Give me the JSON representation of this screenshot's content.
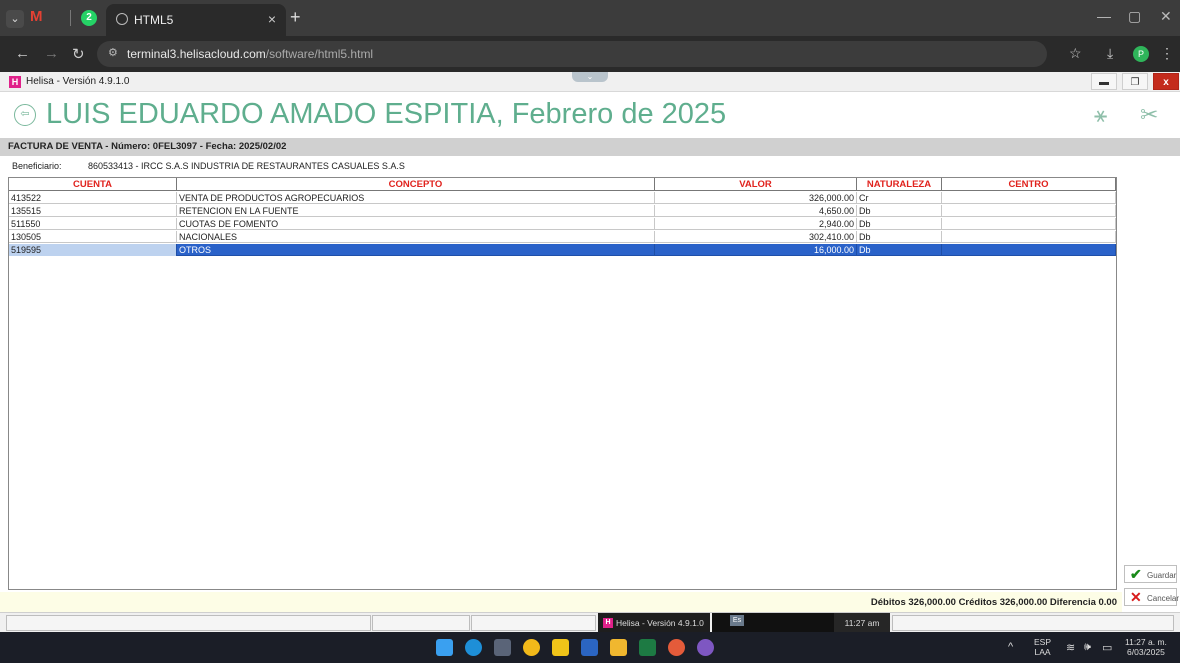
{
  "browser": {
    "tab_title": "HTML5",
    "url_host": "terminal3.helisacloud.com",
    "url_path": "/software/html5.html",
    "whatsapp_badge": "2",
    "profile_initial": "P"
  },
  "app": {
    "window_title": "Helisa - Versión 4.9.1.0",
    "company_title": "LUIS EDUARDO AMADO ESPITIA, Febrero de 2025",
    "doc_info": "FACTURA DE VENTA - Número: 0FEL3097 - Fecha: 2025/02/02",
    "beneficiary_label": "Beneficiario:",
    "beneficiary_value": "860533413 - IRCC S.A.S INDUSTRIA DE RESTAURANTES CASUALES S.A.S",
    "accent_color": "#5fae8e",
    "header_red": "#e0221d",
    "selection_color": "#2a62c9"
  },
  "table": {
    "headers": [
      "CUENTA",
      "CONCEPTO",
      "VALOR",
      "NATURALEZA",
      "CENTRO"
    ],
    "rows": [
      {
        "cuenta": "413522",
        "concepto": "VENTA DE PRODUCTOS AGROPECUARIOS",
        "valor": "326,000.00",
        "naturaleza": "Cr",
        "centro": ""
      },
      {
        "cuenta": "135515",
        "concepto": "RETENCION EN LA FUENTE",
        "valor": "4,650.00",
        "naturaleza": "Db",
        "centro": ""
      },
      {
        "cuenta": "511550",
        "concepto": "CUOTAS DE FOMENTO",
        "valor": "2,940.00",
        "naturaleza": "Db",
        "centro": ""
      },
      {
        "cuenta": "130505",
        "concepto": "NACIONALES",
        "valor": "302,410.00",
        "naturaleza": "Db",
        "centro": ""
      },
      {
        "cuenta": "519595",
        "concepto": "OTROS",
        "valor": "16,000.00",
        "naturaleza": "Db",
        "centro": ""
      }
    ],
    "selected_row": 4
  },
  "totals": {
    "text": "Débitos 326,000.00   Créditos 326,000.00   Diferencia 0.00"
  },
  "buttons": {
    "save": "Guardar",
    "cancel": "Cancelar"
  },
  "statusbar": {
    "task_label": "Helisa - Versión 4.9.1.0",
    "kbd": "Es",
    "time": "11:27 am"
  },
  "tray": {
    "lang": "ESP",
    "lang_sub": "LAA",
    "time": "11:27 a. m.",
    "date": "6/03/2025"
  }
}
